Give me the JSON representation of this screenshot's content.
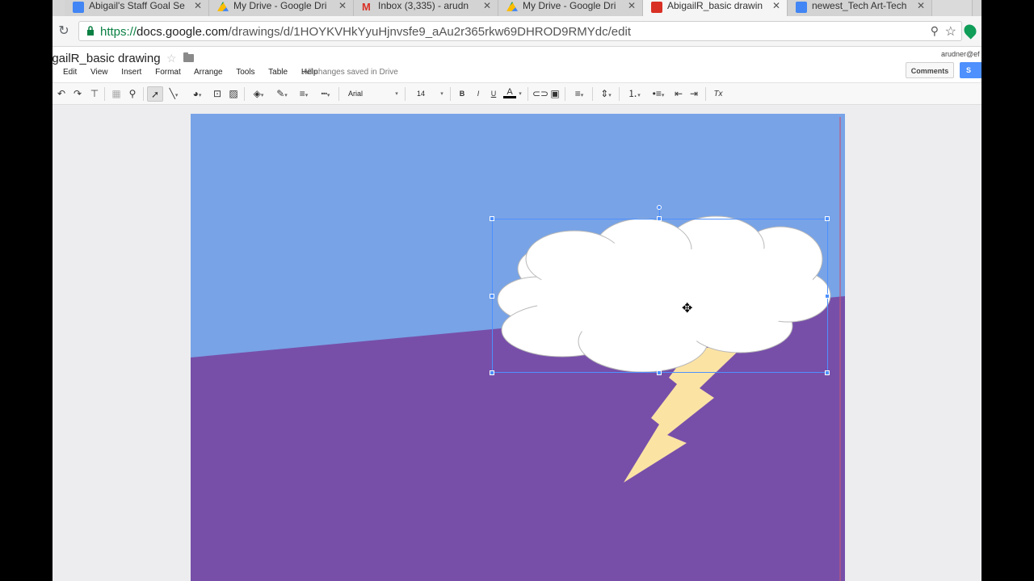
{
  "browser": {
    "tabs": [
      {
        "title": "Abigail's Staff Goal Se",
        "icon": "google-docs-icon",
        "color": "#4285f4"
      },
      {
        "title": "My Drive - Google Dri",
        "icon": "google-drive-icon",
        "color": "#fbbc04"
      },
      {
        "title": "Inbox (3,335) - arudn",
        "icon": "gmail-icon",
        "color": "#d93025"
      },
      {
        "title": "My Drive - Google Dri",
        "icon": "google-drive-icon",
        "color": "#fbbc04"
      },
      {
        "title": "AbigailR_basic drawin",
        "icon": "google-drawings-icon",
        "color": "#d93025",
        "active": true
      },
      {
        "title": "newest_Tech Art-Tech",
        "icon": "google-docs-icon",
        "color": "#4285f4"
      }
    ],
    "url_proto": "https://",
    "url_host": "docs.google.com",
    "url_path": "/drawings/d/1HOYKVHkYyuHjnvsfe9_aAu2r365rkw69DHROD9RMYdc/edit"
  },
  "doc": {
    "title": "igailR_basic drawing",
    "menus": [
      "Edit",
      "View",
      "Insert",
      "Format",
      "Arrange",
      "Tools",
      "Table",
      "Help"
    ],
    "save_status": "All changes saved in Drive",
    "account": "arudner@ef",
    "comments_label": "Comments",
    "share_label": "S"
  },
  "toolbar": {
    "font": "Arial",
    "font_size": "14",
    "bold": "B",
    "italic": "I",
    "underline": "U",
    "text_color": "A",
    "clear_format": "Tx"
  },
  "colors": {
    "sky": "#78a3e6",
    "ground": "#774fa9",
    "cloud": "#ffffff",
    "bolt": "#fbe3a4",
    "selection": "#4d90fe"
  }
}
